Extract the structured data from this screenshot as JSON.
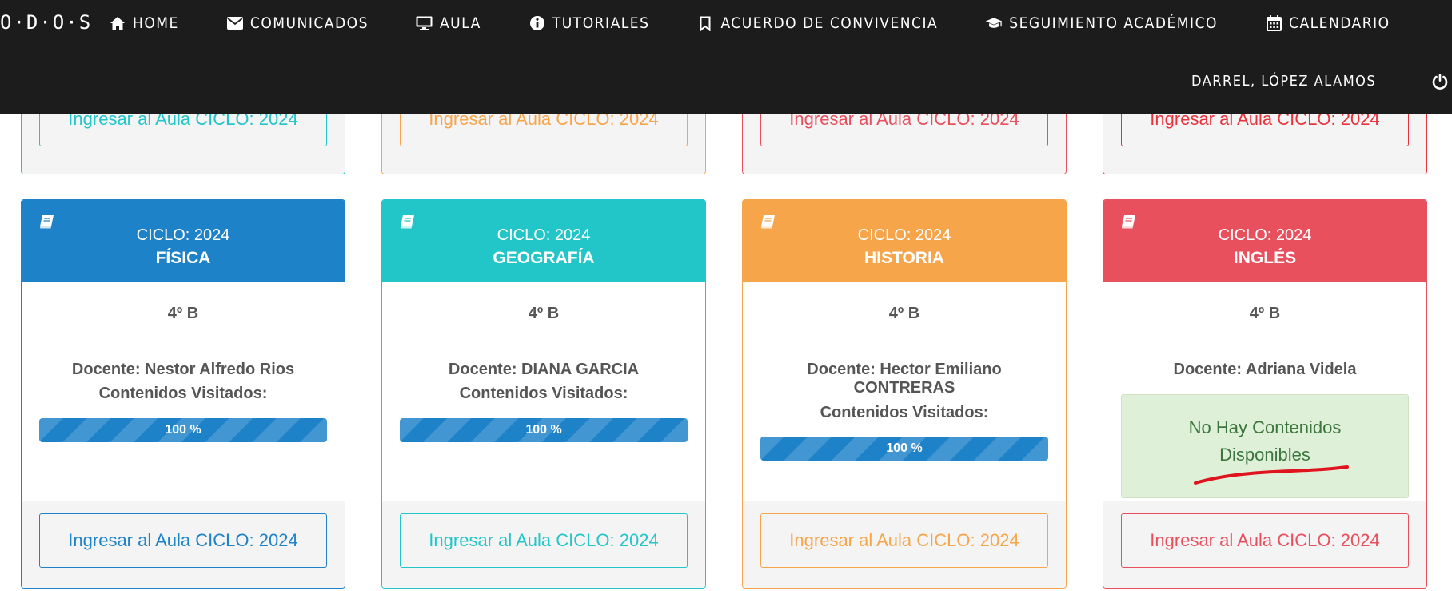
{
  "brand": {
    "logo_text": "O·D·O·S"
  },
  "nav": {
    "items": [
      {
        "label": "HOME",
        "icon": "home-icon"
      },
      {
        "label": "COMUNICADOS",
        "icon": "envelope-icon"
      },
      {
        "label": "AULA",
        "icon": "monitor-icon"
      },
      {
        "label": "TUTORIALES",
        "icon": "info-circle-icon"
      },
      {
        "label": "ACUERDO DE CONVIVENCIA",
        "icon": "bookmark-icon"
      },
      {
        "label": "SEGUIMIENTO ACADÉMICO",
        "icon": "graduation-cap-icon"
      },
      {
        "label": "CALENDARIO",
        "icon": "calendar-icon"
      }
    ],
    "user_name": "DARREL, LÓPEZ ALAMOS",
    "logout_icon": "power-icon"
  },
  "top_row": {
    "cards": [
      {
        "button_label": "Ingresar al Aula CICLO: 2024",
        "color": "#22c5c8"
      },
      {
        "button_label": "Ingresar al Aula CICLO: 2024",
        "color": "#f7a54b"
      },
      {
        "button_label": "Ingresar al Aula CICLO: 2024",
        "color": "#e8505e"
      },
      {
        "button_label": "Ingresar al Aula CICLO: 2024",
        "color": "#e8323c"
      }
    ]
  },
  "courses": [
    {
      "ciclo": "CICLO: 2024",
      "subject": "FÍSICA",
      "grade": "4º B",
      "teacher": "Docente: Nestor Alfredo Rios",
      "visited_label": "Contenidos Visitados:",
      "progress": 100,
      "progress_label": "100 %",
      "button_label": "Ingresar al Aula CICLO: 2024",
      "color": "#1e82c8"
    },
    {
      "ciclo": "CICLO: 2024",
      "subject": "GEOGRAFÍA",
      "grade": "4º B",
      "teacher": "Docente: DIANA GARCIA",
      "visited_label": "Contenidos Visitados:",
      "progress": 100,
      "progress_label": "100 %",
      "button_label": "Ingresar al Aula CICLO: 2024",
      "color": "#22c5c8"
    },
    {
      "ciclo": "CICLO: 2024",
      "subject": "HISTORIA",
      "grade": "4º B",
      "teacher": "Docente: Hector Emiliano CONTRERAS",
      "visited_label": "Contenidos Visitados:",
      "progress": 100,
      "progress_label": "100 %",
      "button_label": "Ingresar al Aula CICLO: 2024",
      "color": "#f7a54b"
    },
    {
      "ciclo": "CICLO: 2024",
      "subject": "INGLÉS",
      "grade": "4º B",
      "teacher": "Docente: Adriana Videla",
      "no_content_label": "No Hay Contenidos Disponibles",
      "button_label": "Ingresar al Aula CICLO: 2024",
      "color": "#e8505e"
    }
  ],
  "annotation_color": "#e0141e"
}
